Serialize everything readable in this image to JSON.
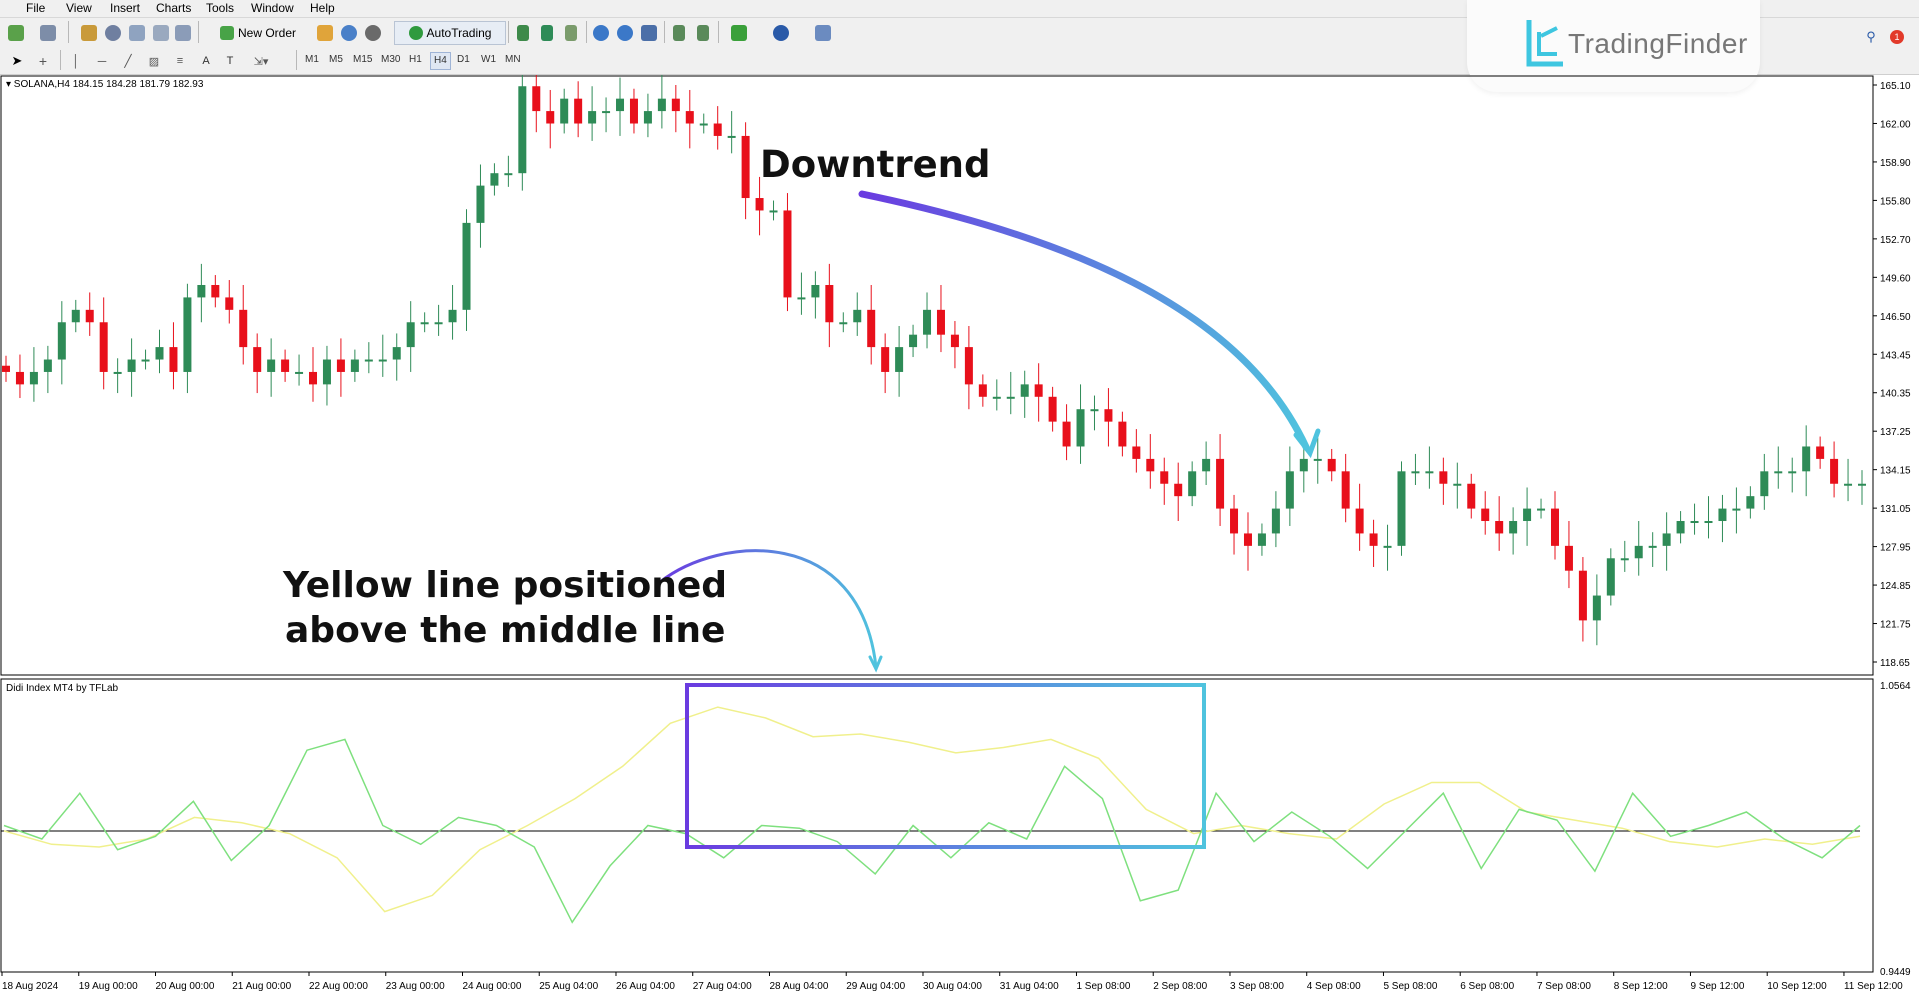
{
  "menu": [
    "File",
    "View",
    "Insert",
    "Charts",
    "Tools",
    "Window",
    "Help"
  ],
  "toolbar": {
    "new_order": "New Order",
    "autotrading": "AutoTrading"
  },
  "timeframes": [
    "M1",
    "M5",
    "M15",
    "M30",
    "H1",
    "H4",
    "D1",
    "W1",
    "MN"
  ],
  "active_timeframe": "H4",
  "brand": {
    "name": "TradingFinder",
    "accent": "#3ec6e0"
  },
  "main_chart": {
    "header": "SOLANA,H4  184.15 184.28 181.79 182.93",
    "price_axis": [
      "165.10",
      "162.00",
      "158.90",
      "155.80",
      "152.70",
      "149.60",
      "146.50",
      "143.45",
      "140.35",
      "137.25",
      "134.15",
      "131.05",
      "127.95",
      "124.85",
      "121.75",
      "118.65"
    ],
    "bull_color": "#2e8b57",
    "bear_color": "#e8101b"
  },
  "indicator": {
    "header": "Didi Index MT4 by TFLab",
    "axis_top": "1.0564",
    "axis_bottom": "0.9449",
    "fast_color": "#7ee07e",
    "slow_color": "#f0f08c"
  },
  "time_axis": [
    "18 Aug 2024",
    "19 Aug 00:00",
    "20 Aug 00:00",
    "21 Aug 00:00",
    "22 Aug 00:00",
    "23 Aug 00:00",
    "24 Aug 00:00",
    "25 Aug 04:00",
    "26 Aug 04:00",
    "27 Aug 04:00",
    "28 Aug 04:00",
    "29 Aug 04:00",
    "30 Aug 04:00",
    "31 Aug 04:00",
    "1 Sep 08:00",
    "2 Sep 08:00",
    "3 Sep 08:00",
    "4 Sep 08:00",
    "5 Sep 08:00",
    "6 Sep 08:00",
    "7 Sep 08:00",
    "8 Sep 12:00",
    "9 Sep 12:00",
    "10 Sep 12:00",
    "11 Sep 12:00"
  ],
  "annotations": {
    "downtrend": "Downtrend",
    "yellow_line_1": "Yellow line positioned",
    "yellow_line_2": "above the middle line"
  },
  "chart_data": {
    "type": "candlestick",
    "candles_close": [
      142,
      141,
      142,
      143,
      146,
      147,
      146,
      142,
      142,
      143,
      143,
      144,
      142,
      148,
      149,
      148,
      147,
      144,
      142,
      143,
      142,
      142,
      141,
      143,
      142,
      143,
      143,
      143,
      144,
      146,
      146,
      146,
      147,
      154,
      157,
      158,
      158,
      165,
      163,
      162,
      164,
      162,
      163,
      163,
      164,
      162,
      163,
      164,
      163,
      162,
      162,
      161,
      161,
      156,
      155,
      155,
      148,
      148,
      149,
      146,
      146,
      147,
      144,
      142,
      144,
      145,
      147,
      145,
      144,
      141,
      140,
      140,
      140,
      141,
      140,
      138,
      136,
      139,
      139,
      138,
      136,
      135,
      134,
      133,
      132,
      134,
      135,
      131,
      129,
      128,
      129,
      131,
      134,
      135,
      135,
      134,
      131,
      129,
      128,
      128,
      134,
      134,
      134,
      133,
      133,
      131,
      130,
      129,
      130,
      131,
      131,
      128,
      126,
      122,
      124,
      127,
      127,
      128,
      128,
      129,
      130,
      130,
      130,
      131,
      131,
      132,
      134,
      134,
      134,
      136,
      135,
      133,
      133,
      133
    ],
    "indicator_fast": [
      0.5,
      0.45,
      0.62,
      0.41,
      0.46,
      0.59,
      0.37,
      0.5,
      0.78,
      0.82,
      0.5,
      0.43,
      0.53,
      0.5,
      0.42,
      0.14,
      0.35,
      0.5,
      0.47,
      0.38,
      0.5,
      0.49,
      0.44,
      0.32,
      0.5,
      0.38,
      0.51,
      0.45,
      0.72,
      0.6,
      0.22,
      0.26,
      0.62,
      0.44,
      0.55,
      0.46,
      0.34,
      0.48,
      0.62,
      0.34,
      0.56,
      0.52,
      0.33,
      0.62,
      0.46,
      0.5,
      0.55,
      0.45,
      0.38,
      0.5
    ],
    "indicator_slow": [
      0.48,
      0.43,
      0.42,
      0.45,
      0.53,
      0.51,
      0.47,
      0.38,
      0.18,
      0.24,
      0.41,
      0.5,
      0.6,
      0.72,
      0.88,
      0.94,
      0.9,
      0.83,
      0.84,
      0.81,
      0.77,
      0.79,
      0.82,
      0.75,
      0.56,
      0.47,
      0.5,
      0.47,
      0.45,
      0.58,
      0.66,
      0.66,
      0.55,
      0.52,
      0.49,
      0.44,
      0.42,
      0.45,
      0.43,
      0.46
    ]
  }
}
